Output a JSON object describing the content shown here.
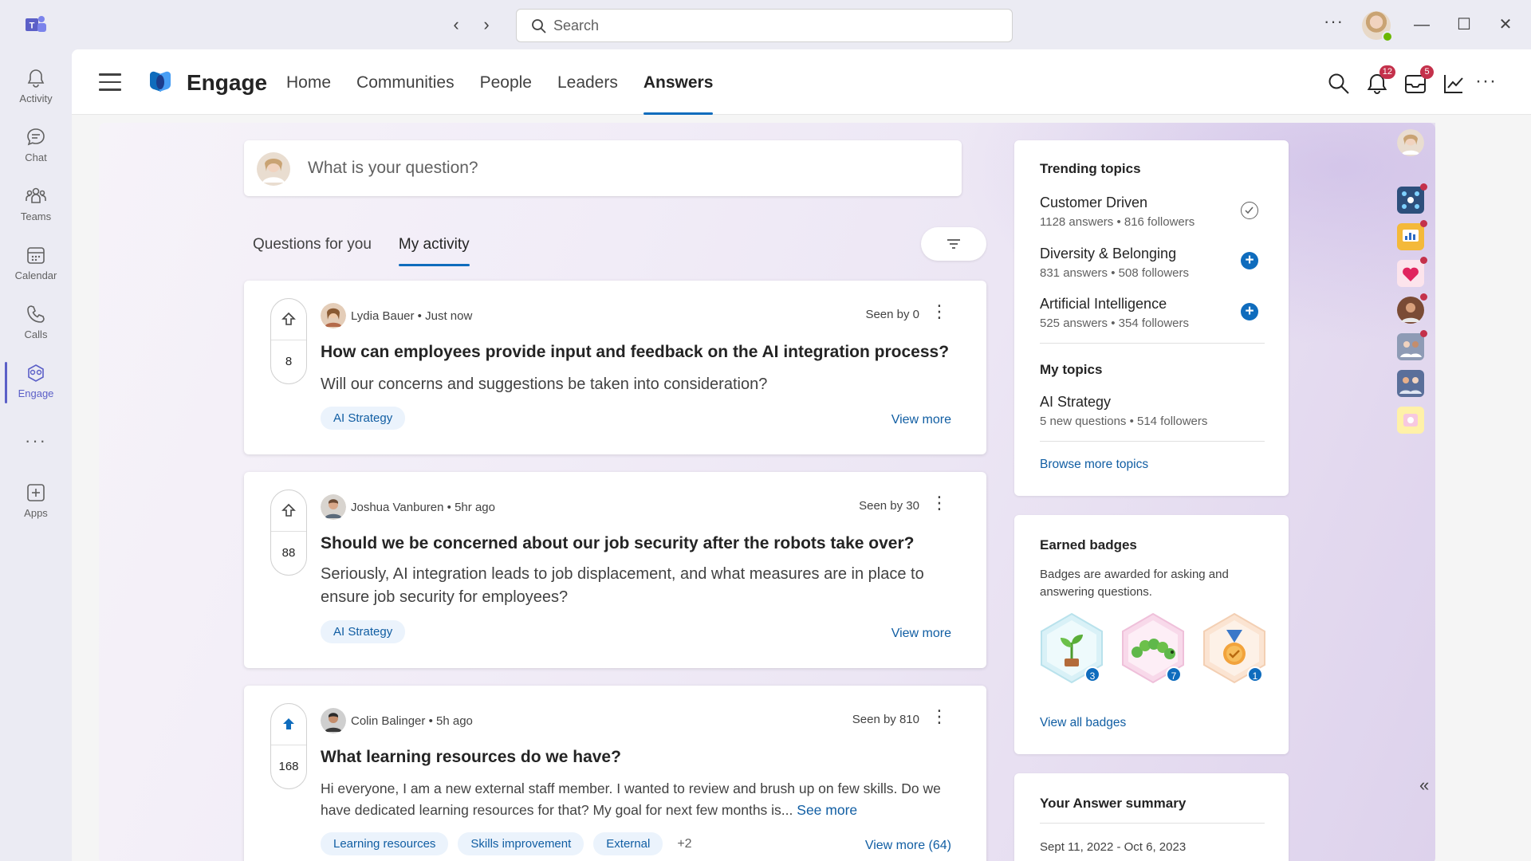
{
  "titlebar": {
    "search_placeholder": "Search",
    "more": "···",
    "minimize": "—",
    "maximize": "☐",
    "close": "✕"
  },
  "rail": {
    "items": [
      {
        "label": "Activity",
        "icon": "bell-icon"
      },
      {
        "label": "Chat",
        "icon": "chat-icon"
      },
      {
        "label": "Teams",
        "icon": "teams-icon"
      },
      {
        "label": "Calendar",
        "icon": "calendar-icon"
      },
      {
        "label": "Calls",
        "icon": "phone-icon"
      },
      {
        "label": "Engage",
        "icon": "engage-icon"
      },
      {
        "label": "Apps",
        "icon": "apps-icon"
      }
    ],
    "more": "···"
  },
  "header": {
    "title": "Engage",
    "tabs": [
      "Home",
      "Communities",
      "People",
      "Leaders",
      "Answers"
    ],
    "active_tab": "Answers",
    "notifications_count": "12",
    "inbox_count": "5",
    "more": "···"
  },
  "ask": {
    "placeholder": "What is your question?"
  },
  "subtabs": [
    "Questions for you",
    "My activity"
  ],
  "questions": [
    {
      "author": "Lydia Bauer",
      "time": "Just now",
      "seen": "Seen by 0",
      "votes": "8",
      "title": "How can employees provide input and feedback on the AI integration process?",
      "body": "Will our concerns and suggestions be taken into consideration?",
      "tags": [
        "AI Strategy"
      ],
      "view_more": "View more"
    },
    {
      "author": "Joshua Vanburen",
      "time": "5hr ago",
      "seen": "Seen by 30",
      "votes": "88",
      "title": "Should we be concerned about our job security after the robots take over?",
      "body": "Seriously, AI integration leads to job displacement, and what measures are in place to ensure job security for employees?",
      "tags": [
        "AI Strategy"
      ],
      "view_more": "View more"
    },
    {
      "author": "Colin Balinger",
      "time": "5h ago",
      "seen": "Seen by 810",
      "votes": "168",
      "title": "What learning resources do we have?",
      "body": "Hi everyone, I am a new external staff member. I wanted to review and brush up on few skills. Do we have dedicated learning resources for that? My goal for next few months is...",
      "see_more": "See more",
      "tags": [
        "Learning resources",
        "Skills improvement",
        "External"
      ],
      "more_tags": "+2",
      "view_more": "View more (64)"
    }
  ],
  "separator": "•",
  "trending": {
    "title": "Trending topics",
    "topics": [
      {
        "name": "Customer Driven",
        "meta": "1128 answers • 816 followers",
        "following": true
      },
      {
        "name": "Diversity & Belonging",
        "meta": "831 answers • 508 followers",
        "following": false
      },
      {
        "name": "Artificial Intelligence",
        "meta": "525 answers • 354 followers",
        "following": false
      }
    ],
    "my_topics_title": "My topics",
    "my_topics": [
      {
        "name": "AI Strategy",
        "meta": "5 new questions • 514 followers"
      }
    ],
    "browse": "Browse more topics",
    "follow_symbol": "+"
  },
  "badges": {
    "title": "Earned badges",
    "description": "Badges are awarded for asking and answering questions.",
    "items": [
      {
        "icon": "sprout-badge-icon",
        "count": "3"
      },
      {
        "icon": "caterpillar-badge-icon",
        "count": "7"
      },
      {
        "icon": "medal-badge-icon",
        "count": "1"
      }
    ],
    "view_all": "View all badges"
  },
  "summary": {
    "title": "Your Answer summary",
    "range": "Sept 11, 2022 - Oct 6, 2023"
  },
  "colors": {
    "accent": "#0f6cbd",
    "teams_purple": "#5b5fc7",
    "notification_red": "#c4314b"
  }
}
